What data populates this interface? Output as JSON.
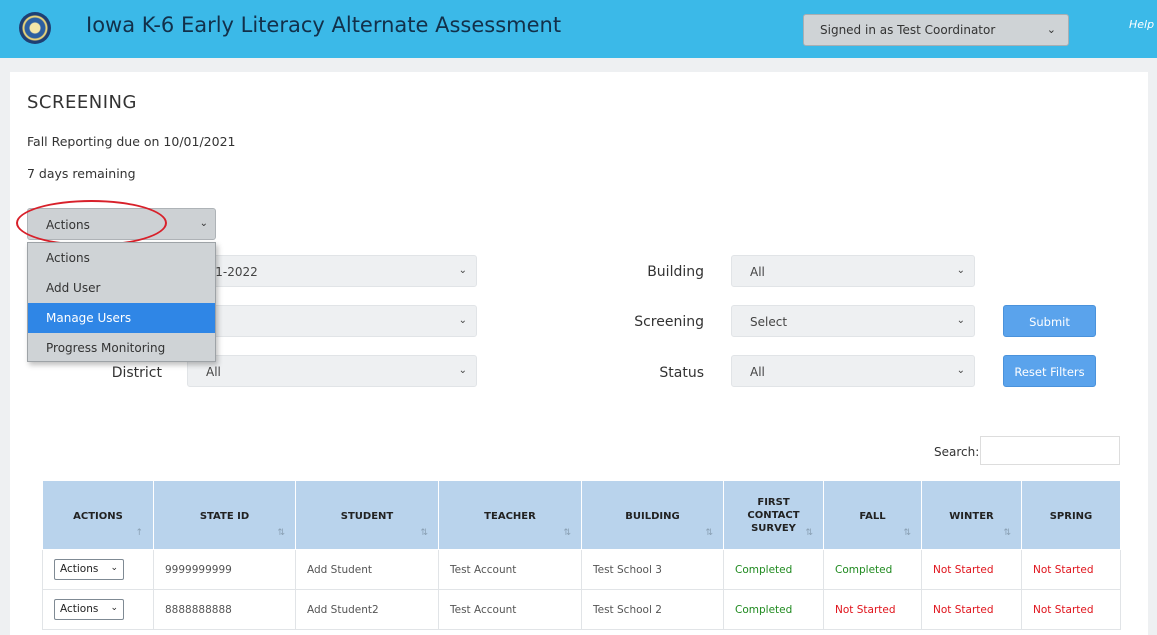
{
  "header": {
    "title": "Iowa K-6 Early Literacy Alternate Assessment",
    "signed_in": "Signed in as Test Coordinator",
    "help": "Help"
  },
  "page": {
    "title": "SCREENING",
    "due": "Fall Reporting due on 10/01/2021",
    "remaining": "7 days remaining"
  },
  "actions_select": {
    "value": "Actions",
    "options": [
      "Actions",
      "Add User",
      "Manage Users",
      "Progress Monitoring"
    ],
    "highlighted": "Manage Users"
  },
  "filters": {
    "year_partial": "021-2022",
    "row2_partial": "l",
    "district_label": "District",
    "district_value": "All",
    "building_label": "Building",
    "building_value": "All",
    "screening_label": "Screening",
    "screening_value": "Select",
    "status_label": "Status",
    "status_value": "All",
    "submit": "Submit",
    "reset": "Reset Filters"
  },
  "search": {
    "label": "Search:"
  },
  "table": {
    "headers": [
      "ACTIONS",
      "STATE ID",
      "STUDENT",
      "TEACHER",
      "BUILDING",
      "FIRST CONTACT SURVEY",
      "FALL",
      "WINTER",
      "SPRING"
    ],
    "rows": [
      {
        "action": "Actions",
        "state_id": "9999999999",
        "student": "Add Student",
        "teacher": "Test Account",
        "building": "Test School 3",
        "survey": "Completed",
        "fall": "Completed",
        "winter": "Not Started",
        "spring": "Not Started"
      },
      {
        "action": "Actions",
        "state_id": "8888888888",
        "student": "Add Student2",
        "teacher": "Test Account",
        "building": "Test School 2",
        "survey": "Completed",
        "fall": "Not Started",
        "winter": "Not Started",
        "spring": "Not Started"
      }
    ]
  }
}
